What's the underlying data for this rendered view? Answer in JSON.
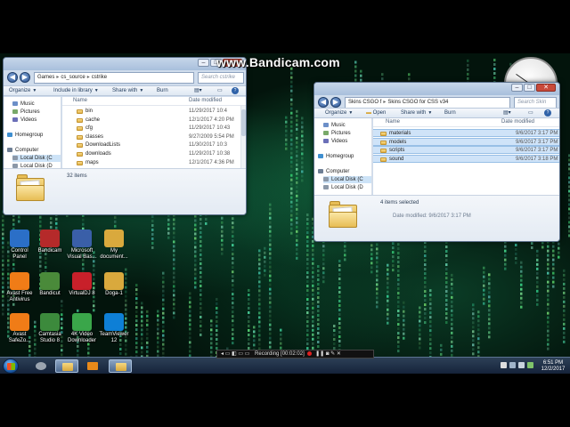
{
  "watermark": "www.Bandicam.com",
  "window1": {
    "address": [
      "Games",
      "cs_source",
      "cstrike"
    ],
    "search_placeholder": "Search cstrike",
    "toolbar": {
      "organize": "Organize",
      "include": "Include in library",
      "share": "Share with",
      "burn": "Burn"
    },
    "nav": [
      {
        "label": "Music",
        "icon": "music-icon"
      },
      {
        "label": "Pictures",
        "icon": "pictures-icon"
      },
      {
        "label": "Videos",
        "icon": "videos-icon"
      },
      {
        "label": "Homegroup",
        "icon": "homegroup-icon"
      },
      {
        "label": "Computer",
        "icon": "computer-icon"
      },
      {
        "label": "Local Disk (C",
        "icon": "drive-icon"
      },
      {
        "label": "Local Disk (D",
        "icon": "drive-icon"
      }
    ],
    "columns": {
      "name": "Name",
      "date": "Date modified"
    },
    "rows": [
      {
        "name": "bin",
        "date": "11/29/2017 10:4"
      },
      {
        "name": "cache",
        "date": "12/1/2017 4:20 PM"
      },
      {
        "name": "cfg",
        "date": "11/29/2017 10:43"
      },
      {
        "name": "classes",
        "date": "9/27/2009 5:54 PM"
      },
      {
        "name": "DownloadLists",
        "date": "11/30/2017 10:3"
      },
      {
        "name": "downloads",
        "date": "11/29/2017 10:38"
      },
      {
        "name": "maps",
        "date": "12/1/2017 4:36 PM"
      }
    ],
    "status": "32 items"
  },
  "window2": {
    "address": [
      "Skins CSGO f",
      "Skins CSGO for CSS v34"
    ],
    "search_placeholder": "Search Skin",
    "toolbar": {
      "organize": "Organize",
      "open": "Open",
      "share": "Share with",
      "burn": "Burn"
    },
    "nav": [
      {
        "label": "Music",
        "icon": "music-icon"
      },
      {
        "label": "Pictures",
        "icon": "pictures-icon"
      },
      {
        "label": "Videos",
        "icon": "videos-icon"
      },
      {
        "label": "Homegroup",
        "icon": "homegroup-icon"
      },
      {
        "label": "Computer",
        "icon": "computer-icon"
      },
      {
        "label": "Local Disk (C",
        "icon": "drive-icon"
      },
      {
        "label": "Local Disk (D",
        "icon": "drive-icon"
      }
    ],
    "columns": {
      "name": "Name",
      "date": "Date modified"
    },
    "rows": [
      {
        "name": "materials",
        "date": "9/6/2017 3:17 PM"
      },
      {
        "name": "models",
        "date": "9/6/2017 3:17 PM"
      },
      {
        "name": "scripts",
        "date": "9/6/2017 3:17 PM"
      },
      {
        "name": "sound",
        "date": "9/6/2017 3:18 PM"
      }
    ],
    "status": "4 items selected",
    "date_modified": "Date modified: 9/6/2017 3:17 PM"
  },
  "desktop_icons": [
    {
      "label": "Control Panel",
      "icon": "control-panel-icon",
      "color": "#2b6fc7"
    },
    {
      "label": "Bandicam",
      "icon": "bandicam-icon",
      "color": "#b52a2a"
    },
    {
      "label": "Microsoft Visual Bas...",
      "icon": "visual-basic-icon",
      "color": "#3a5fa8"
    },
    {
      "label": "My document...",
      "icon": "my-documents-icon",
      "color": "#d9a93d"
    },
    {
      "label": "Avast Free Antivirus",
      "icon": "avast-icon",
      "color": "#f07c17"
    },
    {
      "label": "Bandicut",
      "icon": "bandicut-icon",
      "color": "#4a8a3a"
    },
    {
      "label": "VirtualDJ 8",
      "icon": "virtualdj-icon",
      "color": "#c8202a"
    },
    {
      "label": "Doga-1",
      "icon": "folder-icon",
      "color": "#d9a93d"
    },
    {
      "label": "Avast SafeZo...",
      "icon": "avast-safezone-icon",
      "color": "#f07c17"
    },
    {
      "label": "Camtasia Studio 8",
      "icon": "camtasia-icon",
      "color": "#3c8a3c"
    },
    {
      "label": "4K Video Downloader",
      "icon": "4k-video-downloader-icon",
      "color": "#3aa64a"
    },
    {
      "label": "TeamViewer 12",
      "icon": "teamviewer-icon",
      "color": "#0e7fd6"
    }
  ],
  "recorder": {
    "text": "Recording [00:02:02]"
  },
  "taskbar": {
    "time": "6:51 PM",
    "date": "12/2/2017"
  }
}
